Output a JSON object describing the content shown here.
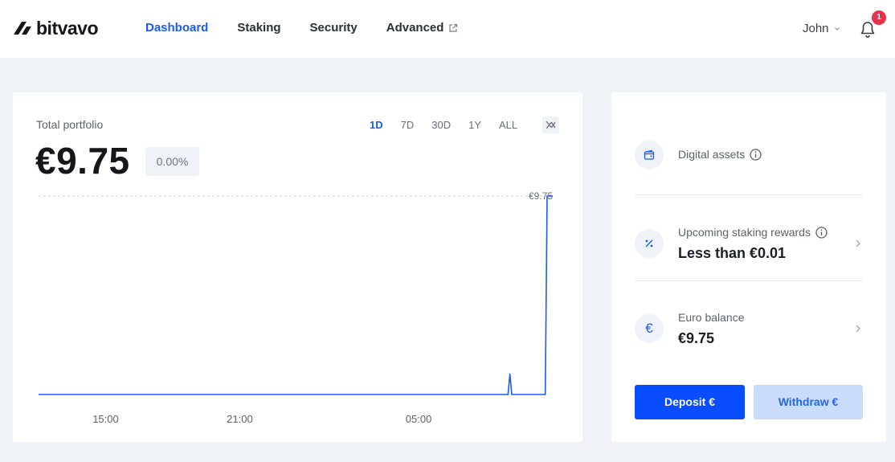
{
  "header": {
    "brand": "bitvavo",
    "nav": [
      "Dashboard",
      "Staking",
      "Security",
      "Advanced"
    ],
    "active_nav": "Dashboard",
    "user_name": "John",
    "notification_count": "1"
  },
  "portfolio": {
    "label": "Total portfolio",
    "value": "€9.75",
    "change": "0.00%",
    "ranges": [
      "1D",
      "7D",
      "30D",
      "1Y",
      "ALL"
    ],
    "active_range": "1D"
  },
  "chart_data": {
    "type": "line",
    "x_ticks": [
      "15:00",
      "21:00",
      "05:00"
    ],
    "x": [
      "12:00",
      "15:00",
      "18:00",
      "21:00",
      "00:00",
      "03:00",
      "05:00",
      "08:00",
      "09:00",
      "09:05",
      "09:10",
      "10:40",
      "10:45",
      "11:00"
    ],
    "series": [
      {
        "values": [
          0,
          0,
          0,
          0,
          0,
          0,
          0,
          0,
          0,
          1.0,
          0,
          0,
          9.75,
          9.75
        ]
      }
    ],
    "max_label": "€9.75",
    "line_color": "#1a5cf5",
    "grid": false
  },
  "summary": {
    "digital_assets_label": "Digital assets",
    "staking_label": "Upcoming staking rewards",
    "staking_value": "Less than €0.01",
    "euro_label": "Euro balance",
    "euro_symbol": "€",
    "euro_value": "€9.75",
    "deposit_label": "Deposit €",
    "withdraw_label": "Withdraw €"
  },
  "colors": {
    "accent": "#1a5cf5",
    "deposit_bg": "#0a4dff",
    "withdraw_bg": "#c9ddfb",
    "badge": "#e6334b"
  }
}
